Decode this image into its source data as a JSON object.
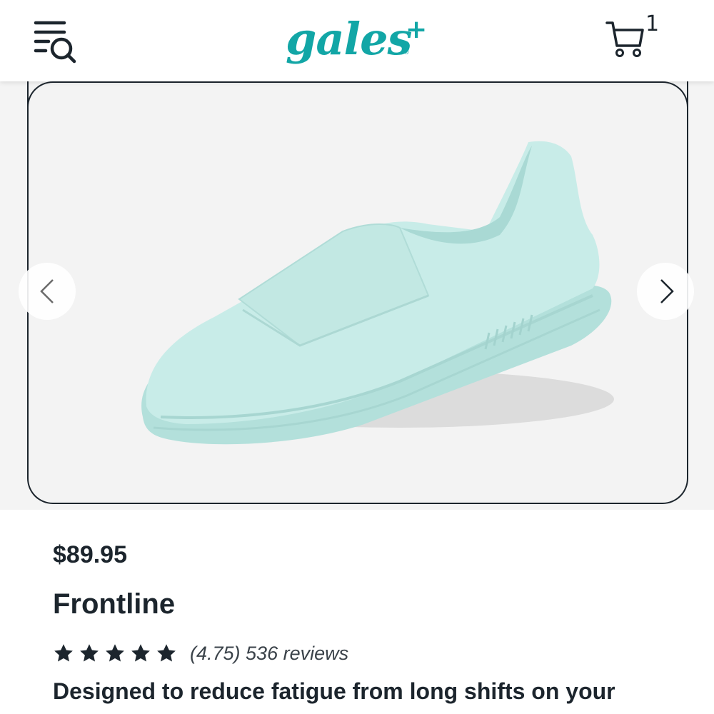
{
  "header": {
    "logo_text": "gales",
    "logo_plus": "+",
    "logo_reg": "®",
    "menu_icon": "menu-search-icon",
    "cart_icon": "cart-icon",
    "cart_count": "1"
  },
  "gallery": {
    "image_alt": "Frontline shoe in mint",
    "prev_icon": "chevron-left-icon",
    "next_icon": "chevron-right-icon",
    "shoe_color": "#c8ece8"
  },
  "product": {
    "price": "$89.95",
    "name": "Frontline",
    "rating_value": 4.75,
    "rating_text": "(4.75) 536 reviews",
    "star_count": 5,
    "description": "Designed to reduce fatigue from long shifts on your"
  },
  "colors": {
    "brand": "#12a6a6",
    "text": "#1c252d"
  }
}
